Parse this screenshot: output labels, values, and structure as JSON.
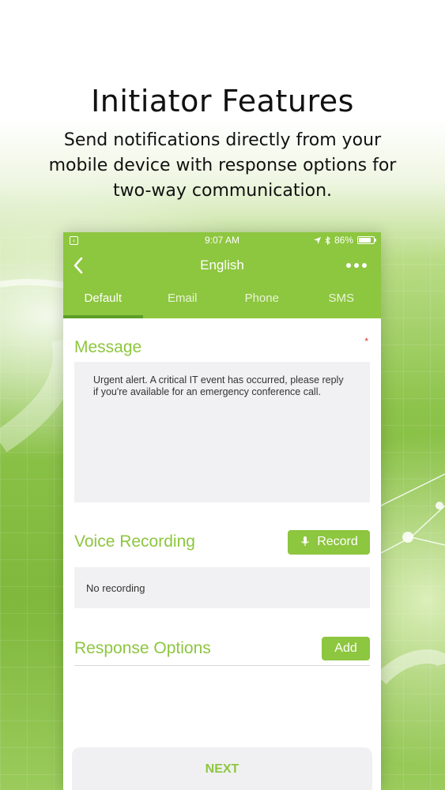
{
  "headline": {
    "title": "Initiator Features",
    "subtitle": "Send notifications directly from your mobile device with response options for two-way communication."
  },
  "status_bar": {
    "time": "9:07 AM",
    "battery": "86%",
    "battery_level": 0.86,
    "icons": [
      "back-app-icon",
      "location-arrow-icon",
      "bluetooth-icon",
      "battery-icon"
    ]
  },
  "nav": {
    "title": "English",
    "back_icon": "chevron-left-icon",
    "more_icon": "more-dots-icon"
  },
  "tabs": [
    {
      "label": "Default",
      "active": true
    },
    {
      "label": "Email",
      "active": false
    },
    {
      "label": "Phone",
      "active": false
    },
    {
      "label": "SMS",
      "active": false
    }
  ],
  "message": {
    "title": "Message",
    "required_mark": "*",
    "text": "Urgent alert. A critical IT event has occurred, please reply if you're available for an emergency conference call."
  },
  "voice": {
    "title": "Voice Recording",
    "record_label": "Record",
    "record_icon": "microphone-icon",
    "status": "No recording"
  },
  "response": {
    "title": "Response Options",
    "add_label": "Add"
  },
  "footer": {
    "next_label": "NEXT"
  },
  "colors": {
    "accent": "#8dc63f",
    "tab_indicator": "#5e9e28",
    "required": "#d9342b",
    "field_bg": "#f1f1f3"
  }
}
